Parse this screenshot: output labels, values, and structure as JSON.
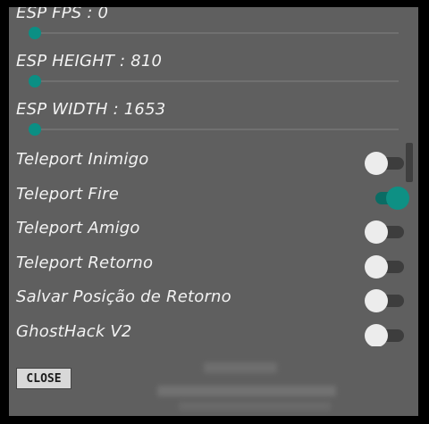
{
  "sliders": [
    {
      "label": "ESP FPS : 0",
      "value": 0
    },
    {
      "label": "ESP HEIGHT : 810",
      "value": 0
    },
    {
      "label": "ESP WIDTH : 1653",
      "value": 0
    }
  ],
  "toggles": [
    {
      "label": "Teleport Inimigo",
      "on": false
    },
    {
      "label": "Teleport Fire",
      "on": true
    },
    {
      "label": "Teleport Amigo",
      "on": false
    },
    {
      "label": "Teleport Retorno",
      "on": false
    },
    {
      "label": "Salvar Posição de Retorno",
      "on": false
    },
    {
      "label": "GhostHack V2",
      "on": false
    }
  ],
  "close_label": "CLOSE",
  "colors": {
    "panel": "#5f5f5f",
    "accent": "#0e9084",
    "frame": "#000000"
  }
}
